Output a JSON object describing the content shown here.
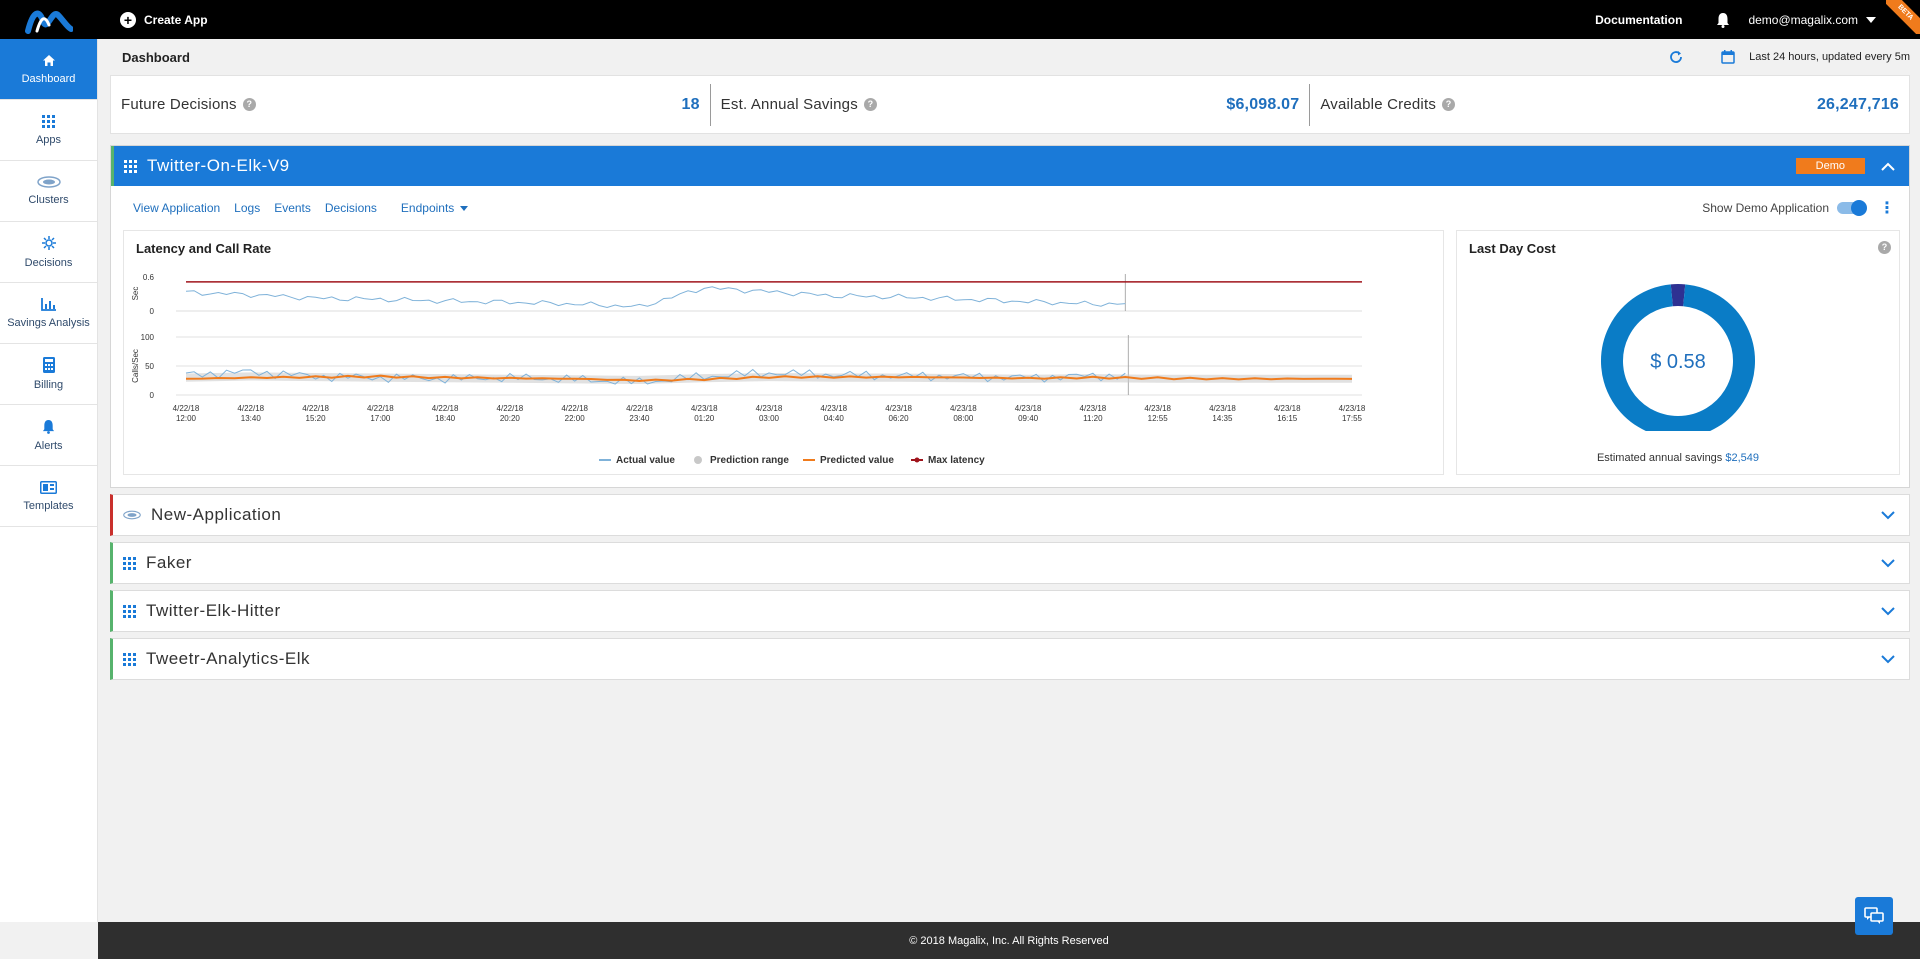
{
  "topbar": {
    "create_app": "Create App",
    "documentation": "Documentation",
    "user_email": "demo@magalix.com",
    "beta": "BETA"
  },
  "sidebar": {
    "items": [
      {
        "label": "Dashboard",
        "icon": "home-icon",
        "active": true
      },
      {
        "label": "Apps",
        "icon": "grid-icon"
      },
      {
        "label": "Clusters",
        "icon": "cluster-icon"
      },
      {
        "label": "Decisions",
        "icon": "decisions-icon"
      },
      {
        "label": "Savings Analysis",
        "icon": "chart-icon"
      },
      {
        "label": "Billing",
        "icon": "calculator-icon"
      },
      {
        "label": "Alerts",
        "icon": "bell-icon"
      },
      {
        "label": "Templates",
        "icon": "template-icon"
      }
    ]
  },
  "header": {
    "title": "Dashboard",
    "update_text": "Last 24 hours, updated every 5m"
  },
  "stats": [
    {
      "label": "Future Decisions",
      "value": "18"
    },
    {
      "label": "Est. Annual Savings",
      "value": "$6,098.07"
    },
    {
      "label": "Available Credits",
      "value": "26,247,716"
    }
  ],
  "expanded_app": {
    "name": "Twitter-On-Elk-V9",
    "badge": "Demo",
    "links": [
      "View Application",
      "Logs",
      "Events",
      "Decisions"
    ],
    "endpoints": "Endpoints",
    "show_demo": "Show Demo Application"
  },
  "latency_title": "Latency and Call Rate",
  "cost": {
    "title": "Last Day Cost",
    "value": "$ 0.58",
    "foot_label": "Estimated annual savings",
    "foot_value": "$2,549"
  },
  "chart_data": [
    {
      "type": "line",
      "title": "Latency and Call Rate",
      "panel": "latency",
      "ylabel": "Sec",
      "ylim": [
        0,
        0.6
      ],
      "yticks": [
        "0.6",
        "0"
      ],
      "x": [
        "4/22/18 12:00",
        "4/22/18 13:40",
        "4/22/18 15:20",
        "4/22/18 17:00",
        "4/22/18 18:40",
        "4/22/18 20:20",
        "4/22/18 22:00",
        "4/22/18 23:40",
        "4/23/18 01:20",
        "4/23/18 03:00",
        "4/23/18 04:40",
        "4/23/18 06:20",
        "4/23/18 08:00",
        "4/23/18 09:40",
        "4/23/18 11:20",
        "4/23/18 12:55",
        "4/23/18 14:35",
        "4/23/18 16:15",
        "4/23/18 17:55"
      ],
      "series": [
        {
          "name": "Actual value",
          "color": "#7fb2d9",
          "values": [
            0.32,
            0.28,
            0.22,
            0.2,
            0.17,
            0.15,
            0.12,
            0.07,
            0.4,
            0.33,
            0.26,
            0.24,
            0.2,
            0.16,
            0.12
          ]
        },
        {
          "name": "Max latency",
          "color": "#a0141c",
          "values": [
            0.5,
            0.5,
            0.5,
            0.5,
            0.5,
            0.5,
            0.5,
            0.5,
            0.5,
            0.5,
            0.5,
            0.5,
            0.5,
            0.5,
            0.5,
            0.5,
            0.5,
            0.5,
            0.5
          ]
        }
      ]
    },
    {
      "type": "line",
      "panel": "calls",
      "ylabel": "Calls/Sec",
      "ylim": [
        0,
        100
      ],
      "yticks": [
        "100",
        "50",
        "0"
      ],
      "x": [
        "4/22/18 12:00",
        "4/22/18 13:40",
        "4/22/18 15:20",
        "4/22/18 17:00",
        "4/22/18 18:40",
        "4/22/18 20:20",
        "4/22/18 22:00",
        "4/22/18 23:40",
        "4/23/18 01:20",
        "4/23/18 03:00",
        "4/23/18 04:40",
        "4/23/18 06:20",
        "4/23/18 08:00",
        "4/23/18 09:40",
        "4/23/18 11:20",
        "4/23/18 12:55",
        "4/23/18 14:35",
        "4/23/18 16:15",
        "4/23/18 17:55"
      ],
      "series": [
        {
          "name": "Actual value",
          "color": "#7fb2d9",
          "values": [
            35,
            40,
            32,
            30,
            28,
            30,
            27,
            22,
            32,
            38,
            35,
            33,
            32,
            30,
            33
          ]
        },
        {
          "name": "Prediction range",
          "color": "#c8c8c8",
          "values": [
            30,
            32,
            31,
            30,
            29,
            28,
            27,
            26,
            29,
            31,
            30,
            30,
            29,
            28,
            29,
            28,
            28,
            28,
            28
          ]
        },
        {
          "name": "Predicted value",
          "color": "#f07b1c",
          "values": [
            28,
            30,
            31,
            32,
            30,
            29,
            28,
            25,
            27,
            31,
            31,
            31,
            30,
            29,
            30,
            29,
            28,
            28,
            28
          ]
        }
      ]
    },
    {
      "type": "pie",
      "title": "Last Day Cost",
      "center_label": "$ 0.58",
      "slices": [
        {
          "value": 97,
          "color": "#0a7cc6"
        },
        {
          "value": 3,
          "color": "#2e3192"
        }
      ]
    }
  ],
  "legend": [
    {
      "label": "Actual value",
      "color": "#7fb2d9"
    },
    {
      "label": "Prediction range",
      "color": "#c8c8c8"
    },
    {
      "label": "Predicted value",
      "color": "#f07b1c"
    },
    {
      "label": "Max latency",
      "color": "#a0141c"
    }
  ],
  "collapsed_apps": [
    {
      "name": "New-Application",
      "icon": "cluster-icon",
      "status": "red"
    },
    {
      "name": "Faker",
      "icon": "grid-icon",
      "status": "green"
    },
    {
      "name": "Twitter-Elk-Hitter",
      "icon": "grid-icon",
      "status": "green"
    },
    {
      "name": "Tweetr-Analytics-Elk",
      "icon": "grid-icon",
      "status": "green"
    }
  ],
  "footer": "© 2018 Magalix, Inc. All Rights Reserved"
}
